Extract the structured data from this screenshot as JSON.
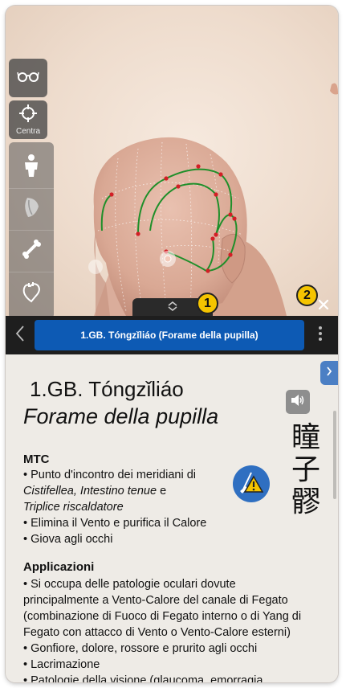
{
  "toolbar": {
    "center_label": "Centra"
  },
  "badges": {
    "one": "1",
    "two": "2"
  },
  "point_bar": {
    "title": "1.GB. Tóngzǐliáo (Forame della pupilla)"
  },
  "point": {
    "code": "1.GB. Tóngzǐliáo",
    "name": "Forame della pupilla",
    "chinese": [
      "瞳",
      "子",
      "髎"
    ]
  },
  "mtc": {
    "title": "MTC",
    "line1": "• Punto d'incontro dei meridiani di",
    "line2_a": "Cistifellea, Intestino tenue",
    "line2_b": " e",
    "line3": "Triplice riscaldatore",
    "line4": "• Elimina il Vento e purifica il Calore",
    "line5": "• Giova agli occhi"
  },
  "applicazioni": {
    "title": "Applicazioni",
    "lines": [
      "• Si occupa delle patologie oculari dovute",
      "principalmente a Vento-Calore del canale di Fegato",
      "(combinazione di Fuoco di Fegato interno o di Yang di",
      "Fegato con attacco di Vento o Vento-Calore esterni)",
      "• Gonfiore, dolore, rossore e prurito agli occhi",
      "• Lacrimazione",
      "• Patologie della visione (glaucoma, emorragia"
    ]
  },
  "icons": {
    "glasses": "glasses-icon",
    "crosshair": "crosshair-icon",
    "body": "body-icon",
    "muscle": "muscle-icon",
    "bone": "bone-icon",
    "organ": "organ-icon",
    "warning": "warning-icon",
    "speaker": "speaker-icon"
  },
  "colors": {
    "title_pill": "#0d5ab4",
    "bar_bg": "#1e1e1e",
    "badge": "#f5c400",
    "meridian": "#1f8f2a",
    "acupoint": "#d21f26"
  }
}
